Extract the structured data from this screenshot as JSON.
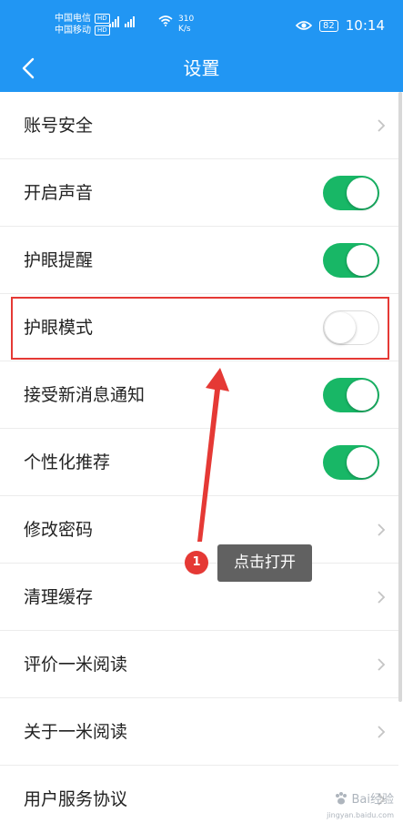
{
  "status_bar": {
    "carrier_1": "中国电信",
    "carrier_2": "中国移动",
    "hd_badge": "HD",
    "network_label": "4G",
    "speed_value": "310",
    "speed_unit": "K/s",
    "battery": "82",
    "time": "10:14",
    "icons": [
      "signal-icon",
      "wifi-icon",
      "eye-icon",
      "battery-icon"
    ]
  },
  "header": {
    "title": "设置",
    "back_icon": "chevron-left-icon"
  },
  "settings": {
    "items": [
      {
        "label": "账号安全",
        "control": "chevron"
      },
      {
        "label": "开启声音",
        "control": "toggle",
        "on": true
      },
      {
        "label": "护眼提醒",
        "control": "toggle",
        "on": true
      },
      {
        "label": "护眼模式",
        "control": "toggle",
        "on": false
      },
      {
        "label": "接受新消息通知",
        "control": "toggle",
        "on": true
      },
      {
        "label": "个性化推荐",
        "control": "toggle",
        "on": true
      },
      {
        "label": "修改密码",
        "control": "chevron"
      },
      {
        "label": "清理缓存",
        "control": "chevron"
      },
      {
        "label": "评价一米阅读",
        "control": "chevron"
      },
      {
        "label": "关于一米阅读",
        "control": "chevron"
      },
      {
        "label": "用户服务协议",
        "control": "chevron"
      }
    ]
  },
  "annotation": {
    "step_number": "1",
    "tip_text": "点击打开"
  },
  "watermark": {
    "text": "Bai经验",
    "url_text": "jingyan.baidu.com"
  },
  "colors": {
    "header_bg": "#2196f3",
    "toggle_on": "#18b766",
    "highlight": "#e53935",
    "tooltip_bg": "#616161"
  }
}
